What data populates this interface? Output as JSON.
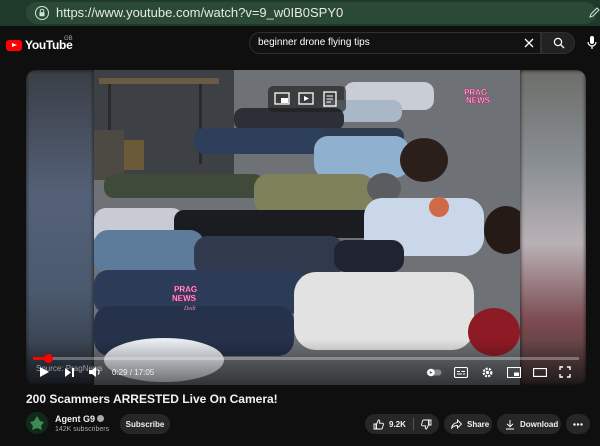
{
  "browser": {
    "url": "https://www.youtube.com/watch?v=9_w0IB0SPY0"
  },
  "header": {
    "logo_text": "YouTube",
    "region_code": "GB",
    "search_query": "beginner drone flying tips"
  },
  "player": {
    "source_label": "Source: PragNews",
    "current_time": "0:29",
    "duration": "17:05",
    "time_display": "0:29 / 17:05",
    "progress_fraction": 0.028,
    "watermark_top": [
      "PRAG",
      "NEWS"
    ],
    "watermark_center": [
      "PRAG",
      "NEWS",
      "Dedi"
    ]
  },
  "video": {
    "title": "200 Scammers ARRESTED Live On Camera!"
  },
  "channel": {
    "name": "Agent G9",
    "subscribers": "142K subscribers",
    "subscribe_label": "Subscribe"
  },
  "actions": {
    "like_count": "9.2K",
    "share_label": "Share",
    "download_label": "Download"
  },
  "colors": {
    "accent": "#ff0000",
    "background": "#0f0f0f",
    "browser_chrome": "#1f3a2a"
  }
}
